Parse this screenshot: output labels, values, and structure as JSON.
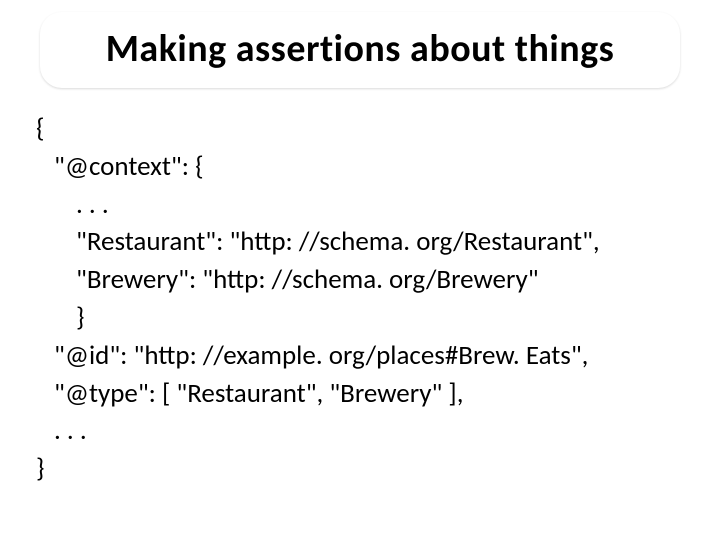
{
  "title": "Making assertions about things",
  "code": {
    "l0": "{",
    "l1": "\"@context\": {",
    "l2": ". . .",
    "l3": "\"Restaurant\": \"http: //schema. org/Restaurant\",",
    "l4": "\"Brewery\": \"http: //schema. org/Brewery\"",
    "l5": "}",
    "l6": "\"@id\": \"http: //example. org/places#Brew. Eats\",",
    "l7": "\"@type\": [ \"Restaurant\", \"Brewery\" ],",
    "l8": ". . .",
    "l9": "}"
  }
}
